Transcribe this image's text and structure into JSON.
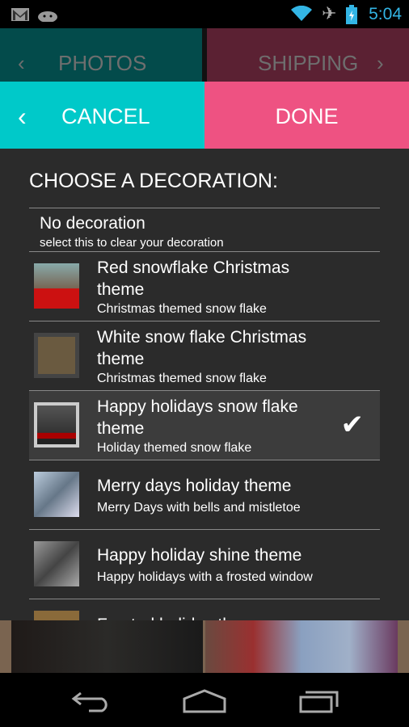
{
  "status_bar": {
    "time": "5:04",
    "icons": [
      "gmail-icon",
      "android-icon",
      "wifi-icon",
      "airplane-icon",
      "battery-charging-icon"
    ],
    "time_color": "#33b5e5"
  },
  "tabs": {
    "prev": "PHOTOS",
    "next": "SHIPPING"
  },
  "actions": {
    "cancel": "CANCEL",
    "done": "DONE",
    "cancel_color": "#00c9c9",
    "done_color": "#ee5282"
  },
  "heading": "CHOOSE A DECORATION:",
  "no_decoration": {
    "title": "No decoration",
    "subtitle": "select this to clear your decoration"
  },
  "items": [
    {
      "title": "Red snowflake Christmas theme",
      "subtitle": "Christmas themed snow flake",
      "selected": false
    },
    {
      "title": "White snow flake Christmas theme",
      "subtitle": "Christmas themed snow flake",
      "selected": false
    },
    {
      "title": "Happy holidays snow flake theme",
      "subtitle": "Holiday themed snow flake",
      "selected": true
    },
    {
      "title": "Merry days holiday theme",
      "subtitle": "Merry Days with bells and mistletoe",
      "selected": false
    },
    {
      "title": "Happy holiday shine theme",
      "subtitle": "Happy holidays with a frosted window",
      "selected": false
    },
    {
      "title": "Frosted holiday theme",
      "subtitle": "",
      "selected": false
    }
  ]
}
